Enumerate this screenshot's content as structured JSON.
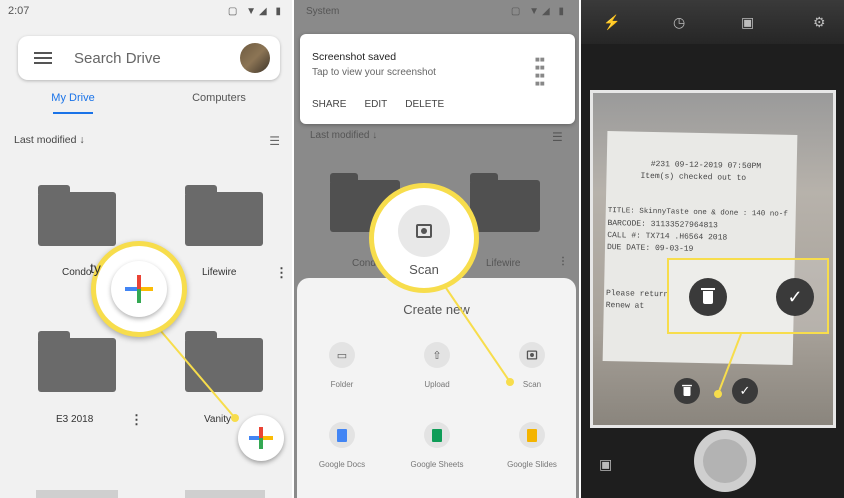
{
  "panel1": {
    "status": {
      "time": "2:07",
      "icons": "▢ ▼◢ ▮"
    },
    "search": {
      "placeholder": "Search Drive"
    },
    "tabs": [
      {
        "label": "My Drive",
        "active": true
      },
      {
        "label": "Computers",
        "active": false
      }
    ],
    "sort_label": "Last modified ↓",
    "folders": [
      {
        "name": "Condo"
      },
      {
        "name": "Lifewire"
      },
      {
        "name": "E3 2018"
      },
      {
        "name": "Vanity"
      }
    ],
    "zoom_fragment": "ty",
    "plus_glyph": "+"
  },
  "panel2": {
    "status_label": "System",
    "notification": {
      "title": "Screenshot saved",
      "subtitle": "Tap to view your screenshot",
      "actions": [
        "SHARE",
        "EDIT",
        "DELETE"
      ]
    },
    "bg_sort_label": "Last modified ↓",
    "bg_folders": [
      "Condo",
      "Lifewire"
    ],
    "zoom_label": "Scan",
    "sheet": {
      "title": "Create new",
      "items": [
        {
          "label": "Folder",
          "icon": "folder-icon"
        },
        {
          "label": "Upload",
          "icon": "upload-icon"
        },
        {
          "label": "Scan",
          "icon": "camera-icon"
        },
        {
          "label": "Google Docs",
          "icon": "docs-icon",
          "color": "#4285f4"
        },
        {
          "label": "Google Sheets",
          "icon": "sheets-icon",
          "color": "#0f9d58"
        },
        {
          "label": "Google Slides",
          "icon": "slides-icon",
          "color": "#f4b400"
        }
      ]
    }
  },
  "panel3": {
    "receipt_lines": [
      "#231  09-12-2019 07:50PM",
      "Item(s) checked out to",
      "TITLE: SkinnyTaste one & done : 140 no-f",
      "BARCODE: 31133527964813",
      "CALL #: TX714 .H6564 2018",
      "DUE DATE: 09-03-19",
      "Please return",
      "Renew at"
    ]
  },
  "colors": {
    "highlight": "#f7dd4c",
    "accent": "#1a73e8"
  }
}
